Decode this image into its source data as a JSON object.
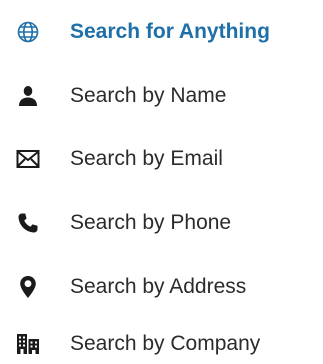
{
  "search_menu": {
    "accent_color": "#1f6fa8",
    "text_color": "#2b2b2b",
    "items": [
      {
        "label": "Search for Anything",
        "icon": "globe-icon",
        "active": true
      },
      {
        "label": "Search by Name",
        "icon": "person-icon",
        "active": false
      },
      {
        "label": "Search by Email",
        "icon": "envelope-icon",
        "active": false
      },
      {
        "label": "Search by Phone",
        "icon": "phone-icon",
        "active": false
      },
      {
        "label": "Search by Address",
        "icon": "map-pin-icon",
        "active": false
      },
      {
        "label": "Search by Company",
        "icon": "building-icon",
        "active": false
      }
    ]
  }
}
